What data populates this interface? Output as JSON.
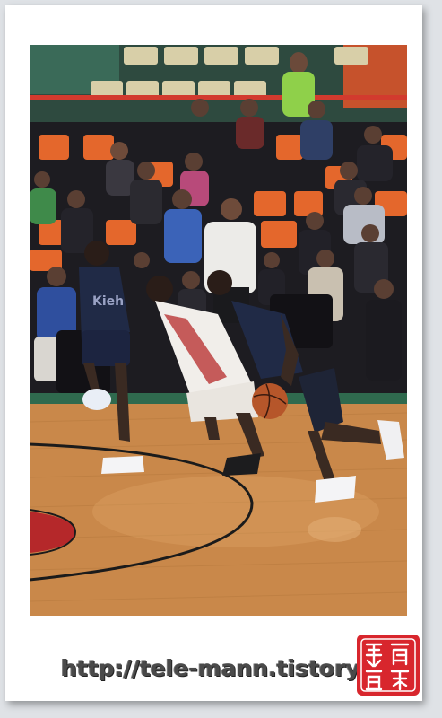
{
  "photo": {
    "alt_subject": "basketball-game-photo",
    "jersey_text": "Kieh"
  },
  "watermark": {
    "url_text": "http://tele-mann.tistory.com"
  },
  "colors": {
    "court_wood": "#c9884a",
    "seat_orange": "#e4672c",
    "crowd_dark": "#1d1c21",
    "seal_red": "#d8262d",
    "white_jersey": "#f1eeea",
    "navy_jersey": "#202a46"
  }
}
